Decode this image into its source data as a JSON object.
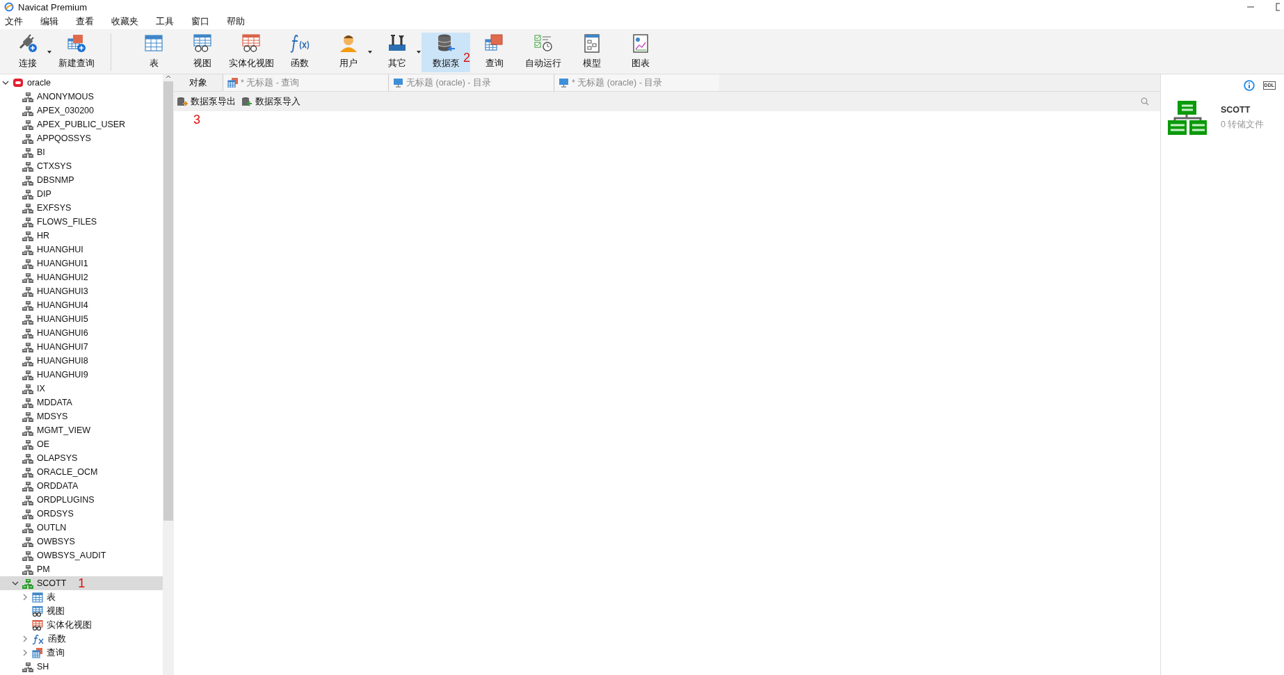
{
  "window": {
    "title": "Navicat Premium"
  },
  "menu": [
    "文件",
    "编辑",
    "查看",
    "收藏夹",
    "工具",
    "窗口",
    "帮助"
  ],
  "toolbar": [
    {
      "buttons": [
        {
          "label": "连接",
          "kind": "connect",
          "dropdown": true,
          "selected": false
        },
        {
          "label": "新建查询",
          "kind": "newquery",
          "dropdown": false,
          "selected": false
        }
      ]
    },
    {
      "buttons": [
        {
          "label": "表",
          "kind": "table",
          "dropdown": false,
          "selected": false
        },
        {
          "label": "视图",
          "kind": "view",
          "dropdown": false,
          "selected": false
        },
        {
          "label": "实体化视图",
          "kind": "matview",
          "dropdown": false,
          "selected": false
        },
        {
          "label": "函数",
          "kind": "function",
          "dropdown": false,
          "selected": false
        },
        {
          "label": "用户",
          "kind": "user",
          "dropdown": true,
          "selected": false
        },
        {
          "label": "其它",
          "kind": "tools",
          "dropdown": true,
          "selected": false
        },
        {
          "label": "数据泵",
          "kind": "datapump",
          "dropdown": false,
          "selected": true,
          "annotation": "2"
        },
        {
          "label": "查询",
          "kind": "query",
          "dropdown": false,
          "selected": false
        },
        {
          "label": "自动运行",
          "kind": "schedule",
          "dropdown": false,
          "selected": false
        },
        {
          "label": "模型",
          "kind": "model",
          "dropdown": false,
          "selected": false
        },
        {
          "label": "图表",
          "kind": "chart",
          "dropdown": false,
          "selected": false
        }
      ]
    }
  ],
  "tree": [
    {
      "label": "oracle",
      "kind": "connection",
      "expanded": true,
      "selected": false,
      "children": [
        {
          "label": "ANONYMOUS",
          "kind": "schema",
          "selected": false
        },
        {
          "label": "APEX_030200",
          "kind": "schema",
          "selected": false
        },
        {
          "label": "APEX_PUBLIC_USER",
          "kind": "schema",
          "selected": false
        },
        {
          "label": "APPQOSSYS",
          "kind": "schema",
          "selected": false
        },
        {
          "label": "BI",
          "kind": "schema",
          "selected": false
        },
        {
          "label": "CTXSYS",
          "kind": "schema",
          "selected": false
        },
        {
          "label": "DBSNMP",
          "kind": "schema",
          "selected": false
        },
        {
          "label": "DIP",
          "kind": "schema",
          "selected": false
        },
        {
          "label": "EXFSYS",
          "kind": "schema",
          "selected": false
        },
        {
          "label": "FLOWS_FILES",
          "kind": "schema",
          "selected": false
        },
        {
          "label": "HR",
          "kind": "schema",
          "selected": false
        },
        {
          "label": "HUANGHUI",
          "kind": "schema",
          "selected": false
        },
        {
          "label": "HUANGHUI1",
          "kind": "schema",
          "selected": false
        },
        {
          "label": "HUANGHUI2",
          "kind": "schema",
          "selected": false
        },
        {
          "label": "HUANGHUI3",
          "kind": "schema",
          "selected": false
        },
        {
          "label": "HUANGHUI4",
          "kind": "schema",
          "selected": false
        },
        {
          "label": "HUANGHUI5",
          "kind": "schema",
          "selected": false
        },
        {
          "label": "HUANGHUI6",
          "kind": "schema",
          "selected": false
        },
        {
          "label": "HUANGHUI7",
          "kind": "schema",
          "selected": false
        },
        {
          "label": "HUANGHUI8",
          "kind": "schema",
          "selected": false
        },
        {
          "label": "HUANGHUI9",
          "kind": "schema",
          "selected": false
        },
        {
          "label": "IX",
          "kind": "schema",
          "selected": false
        },
        {
          "label": "MDDATA",
          "kind": "schema",
          "selected": false
        },
        {
          "label": "MDSYS",
          "kind": "schema",
          "selected": false
        },
        {
          "label": "MGMT_VIEW",
          "kind": "schema",
          "selected": false
        },
        {
          "label": "OE",
          "kind": "schema",
          "selected": false
        },
        {
          "label": "OLAPSYS",
          "kind": "schema",
          "selected": false
        },
        {
          "label": "ORACLE_OCM",
          "kind": "schema",
          "selected": false
        },
        {
          "label": "ORDDATA",
          "kind": "schema",
          "selected": false
        },
        {
          "label": "ORDPLUGINS",
          "kind": "schema",
          "selected": false
        },
        {
          "label": "ORDSYS",
          "kind": "schema",
          "selected": false
        },
        {
          "label": "OUTLN",
          "kind": "schema",
          "selected": false
        },
        {
          "label": "OWBSYS",
          "kind": "schema",
          "selected": false
        },
        {
          "label": "OWBSYS_AUDIT",
          "kind": "schema",
          "selected": false
        },
        {
          "label": "PM",
          "kind": "schema",
          "selected": false
        },
        {
          "label": "SCOTT",
          "kind": "schema",
          "expanded": true,
          "selected": true,
          "annotation": "1",
          "children": [
            {
              "label": "表",
              "kind": "table",
              "expanded": false,
              "selected": false
            },
            {
              "label": "视图",
              "kind": "view",
              "selected": false
            },
            {
              "label": "实体化视图",
              "kind": "matview",
              "selected": false
            },
            {
              "label": "函数",
              "kind": "function",
              "expanded": false,
              "selected": false
            },
            {
              "label": "查询",
              "kind": "query",
              "expanded": false,
              "selected": false
            }
          ]
        },
        {
          "label": "SH",
          "kind": "schema",
          "selected": false
        }
      ]
    }
  ],
  "tabs": [
    {
      "label": "对象",
      "kind": "objects",
      "selected": true
    },
    {
      "label": "* 无标题 - 查询",
      "kind": "query",
      "selected": false
    },
    {
      "label": "无标题 (oracle) - 目录",
      "kind": "catalog",
      "selected": false
    },
    {
      "label": "* 无标题 (oracle) - 目录",
      "kind": "catalog",
      "selected": false
    }
  ],
  "object_toolbar": [
    {
      "label": "数据泵导出",
      "kind": "export"
    },
    {
      "label": "数据泵导入",
      "kind": "import"
    }
  ],
  "content": {
    "annotation": "3"
  },
  "info_panel": {
    "ddl_button": "DDL",
    "name": "SCOTT",
    "subtitle": "0 转储文件"
  }
}
